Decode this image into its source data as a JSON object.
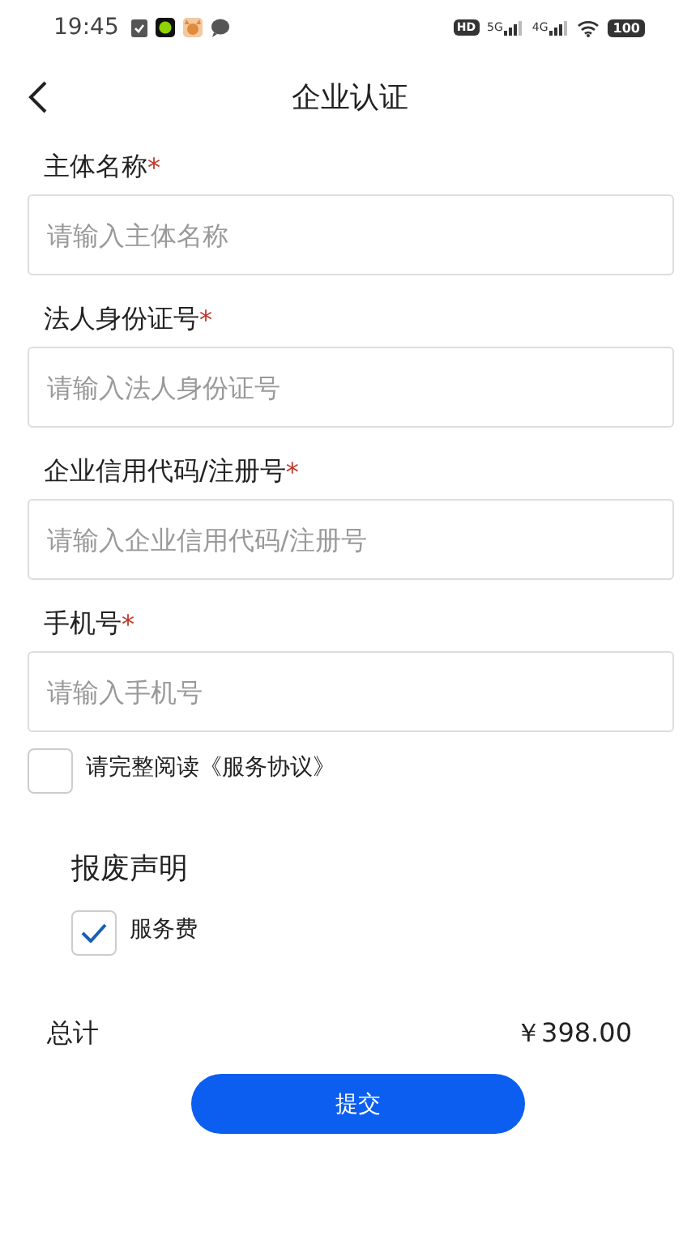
{
  "status_bar": {
    "time": "19:45",
    "hd": "HD",
    "networks": [
      "5G",
      "4G"
    ],
    "battery": "100"
  },
  "header": {
    "title": "企业认证"
  },
  "fields": [
    {
      "label": "主体名称",
      "required_mark": "*",
      "placeholder": "请输入主体名称"
    },
    {
      "label": "法人身份证号",
      "required_mark": "*",
      "placeholder": "请输入法人身份证号"
    },
    {
      "label": "企业信用代码/注册号",
      "required_mark": "*",
      "placeholder": "请输入企业信用代码/注册号"
    },
    {
      "label": "手机号",
      "required_mark": "*",
      "placeholder": "请输入手机号"
    }
  ],
  "agreement": {
    "text": "请完整阅读《服务协议》",
    "checked": false
  },
  "section": {
    "title": "报废声明",
    "options": [
      {
        "label": "服务费",
        "checked": true
      }
    ]
  },
  "total": {
    "label": "总计",
    "amount": "￥398.00"
  },
  "submit": {
    "label": "提交"
  }
}
